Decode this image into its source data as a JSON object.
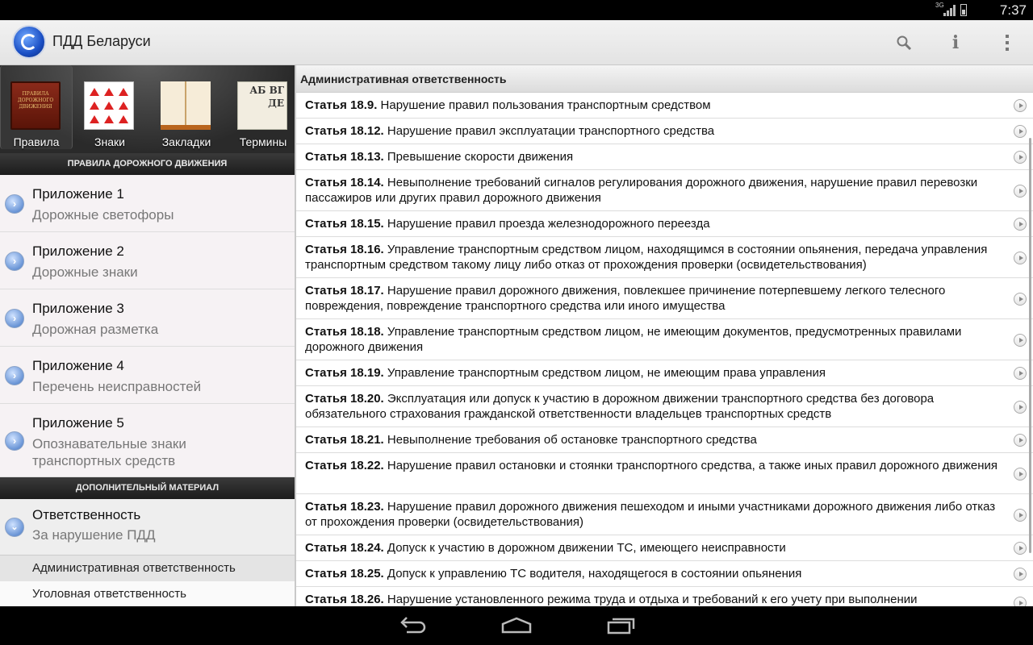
{
  "status_bar": {
    "network": "3G",
    "time": "7:37"
  },
  "app": {
    "title": "ПДД Беларуси"
  },
  "tabs": [
    {
      "label": "Правила",
      "icon": "rules-book-icon",
      "cover_text": "ПРАВИЛА ДОРОЖНОГО ДВИЖЕНИЯ"
    },
    {
      "label": "Знаки",
      "icon": "road-signs-icon"
    },
    {
      "label": "Закладки",
      "icon": "open-book-icon"
    },
    {
      "label": "Термины",
      "icon": "glossary-icon",
      "cover_text": "АБ ВГ ДЕ"
    }
  ],
  "left": {
    "section1": "ПРАВИЛА ДОРОЖНОГО ДВИЖЕНИЯ",
    "appendices": [
      {
        "title": "Приложение 1",
        "subtitle": "Дорожные светофоры"
      },
      {
        "title": "Приложение 2",
        "subtitle": "Дорожные знаки"
      },
      {
        "title": "Приложение 3",
        "subtitle": "Дорожная разметка"
      },
      {
        "title": "Приложение 4",
        "subtitle": "Перечень неисправностей"
      },
      {
        "title": "Приложение 5",
        "subtitle": "Опознавательные знаки транспортных средств"
      }
    ],
    "section2": "ДОПОЛНИТЕЛЬНЫЙ МАТЕРИАЛ",
    "responsibility": {
      "title": "Ответственность",
      "subtitle": "За нарушение ПДД"
    },
    "sub_items": [
      "Административная ответственность",
      "Уголовная ответственность"
    ]
  },
  "right": {
    "header": "Административная ответственность",
    "articles": [
      {
        "num": "Статья 18.9.",
        "text": "Нарушение правил пользования транспортным средством"
      },
      {
        "num": "Статья 18.12.",
        "text": "Нарушение правил эксплуатации транспортного средства"
      },
      {
        "num": "Статья 18.13.",
        "text": "Превышение скорости движения"
      },
      {
        "num": "Статья 18.14.",
        "text": "Невыполнение требований сигналов регулирования дорожного движения, нарушение правил перевозки пассажиров или других правил дорожного движения"
      },
      {
        "num": "Статья 18.15.",
        "text": "Нарушение правил проезда железнодорожного переезда"
      },
      {
        "num": "Статья 18.16.",
        "text": "Управление транспортным средством лицом, находящимся в состоянии опьянения, передача управления транспортным средством такому лицу либо отказ от прохождения проверки (освидетельствования)"
      },
      {
        "num": "Статья 18.17.",
        "text": "Нарушение правил дорожного движения, повлекшее причинение потерпевшему легкого телесного повреждения, повреждение транспортного средства или иного имущества"
      },
      {
        "num": "Статья 18.18.",
        "text": "Управление транспортным средством лицом, не имеющим документов, предусмотренных правилами дорожного движения"
      },
      {
        "num": "Статья 18.19.",
        "text": "Управление транспортным средством лицом, не имеющим права управления"
      },
      {
        "num": "Статья 18.20.",
        "text": "Эксплуатация или допуск к участию в дорожном движении транспортного средства без договора обязательного страхования гражданской ответственности владельцев транспортных средств"
      },
      {
        "num": "Статья 18.21.",
        "text": "Невыполнение требования об остановке транспортного средства"
      },
      {
        "num": "Статья 18.22.",
        "text": "Нарушение правил остановки и стоянки транспортного средства, а также иных правил дорожного движения"
      },
      {
        "num": "Статья 18.23.",
        "text": "Нарушение правил дорожного движения пешеходом и иными участниками дорожного движения либо отказ от прохождения проверки (освидетельствования)"
      },
      {
        "num": "Статья 18.24.",
        "text": "Допуск к участию в дорожном движении ТС, имеющего неисправности"
      },
      {
        "num": "Статья 18.25.",
        "text": "Допуск к управлению ТС водителя, находящегося в состоянии опьянения"
      },
      {
        "num": "Статья 18.26.",
        "text": "Нарушение установленного режима труда и отдыха и требований к его учету при выполнении"
      }
    ]
  }
}
